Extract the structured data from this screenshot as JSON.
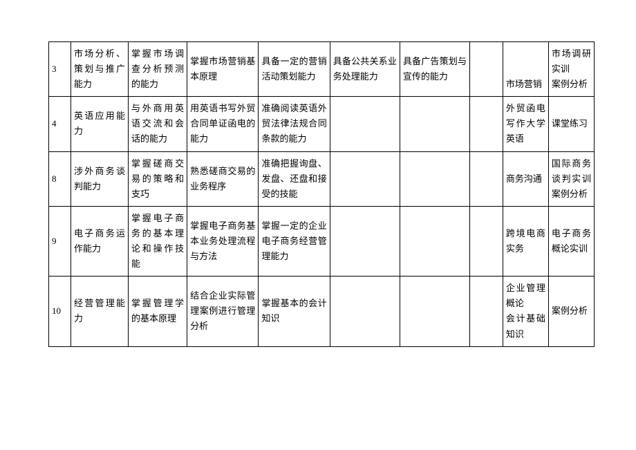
{
  "columns_widths": [
    30,
    80,
    80,
    95,
    95,
    95,
    95,
    40,
    65,
    65
  ],
  "rows": [
    {
      "num": "3",
      "c1": "市场分析、策划与推广能力",
      "c2": "掌握市场调查分析预测的能力",
      "c3": "掌握市场营销基本原理",
      "c4": "具备一定的营销活动策划能力",
      "c5": "具备公共关系业务处理能力",
      "c6": "具备广告策划与宣传的能力",
      "c7": "",
      "c8": "市场营销",
      "c9": "市场调研实训\n案例分析"
    },
    {
      "num": "4",
      "c1": "英语应用能力",
      "c2": "与外商用英语交流和会话的能力",
      "c3": "用英语书写外贸合同单证函电的能力",
      "c4": "准确阅读英语外贸法律法规合同条款的能力",
      "c5": "",
      "c6": "",
      "c7": "",
      "c8": "外贸函电写作大学英语",
      "c9": "课堂练习"
    },
    {
      "num": "8",
      "c1": "涉外商务谈判能力",
      "c2": "掌握磋商交易的策略和支巧",
      "c3": "熟悉磋商交易的业务程序",
      "c4": "准确把握询盘、发盘、还盘和接受的技能",
      "c5": "",
      "c6": "",
      "c7": "",
      "c8": "商务沟通",
      "c9": "国际商务谈判实训案例分析"
    },
    {
      "num": "9",
      "c1": "电子商务运作能力",
      "c2": "掌握电子商务的基本理论和操作技能",
      "c3": "掌握电子商务基本业务处理流程与方法",
      "c4": "掌握一定的企业电子商务经营管理能力",
      "c5": "",
      "c6": "",
      "c7": "",
      "c8": "跨境电商实务",
      "c9": "电子商务概论实训"
    },
    {
      "num": "10",
      "c1": "经营管理能力",
      "c2": "掌握管理学的基本原理",
      "c3": "结合企业实际管理案例进行管理分析",
      "c4": "掌握基本的会计知识",
      "c5": "",
      "c6": "",
      "c7": "",
      "c8": "企业管理概论\n会计基础知识",
      "c9": "案例分析"
    }
  ]
}
